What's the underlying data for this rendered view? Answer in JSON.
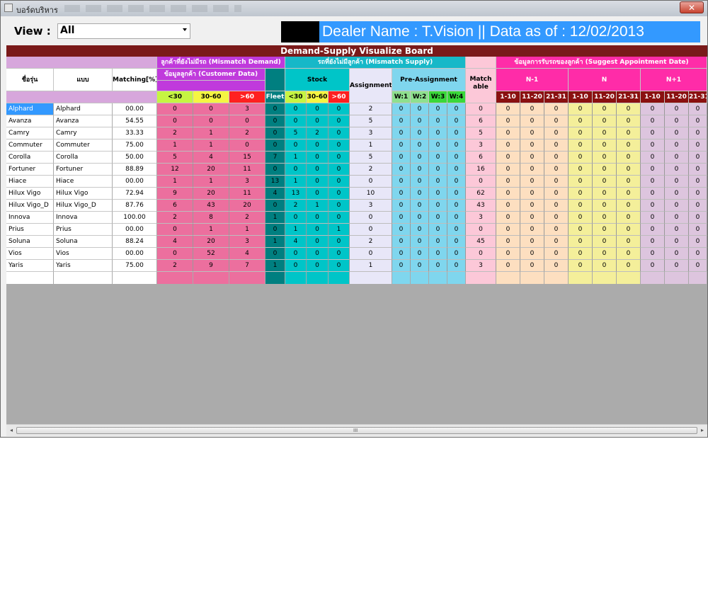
{
  "window": {
    "title": "บอร์ดบริหาร",
    "close_label": "✕"
  },
  "toolbar": {
    "view_label": "View :",
    "view_value": "All",
    "dealer_text": "Dealer Name : T.Vision || Data as of : 12/02/2013"
  },
  "board": {
    "title": "Demand-Supply Visualize Board",
    "groups": {
      "mismatch_demand": "ลูกค้าที่ยังไม่มีรถ (Mismatch Demand)",
      "mismatch_supply": "รถที่ยังไม่มีลูกค้า (Mismatch Supply)",
      "suggest_appointment": "ข้อมูลการรับรถของลูกค้า (Suggest Appointment Date)"
    },
    "subgroups": {
      "customer_data": "ข้อมูลลูกค้า (Customer Data)",
      "stock": "Stock",
      "pre_assignment": "Pre-Assignment",
      "n_minus_1": "N-1",
      "n": "N",
      "n_plus_1": "N+1"
    },
    "headers": {
      "model_code": "ชื่อรุ่น",
      "model": "แบบ",
      "matching": "Matching[%]",
      "assignment": "Assignment",
      "matchable": "Match able",
      "lt30": "<30",
      "d30_60": "30-60",
      "gt60": ">60",
      "fleet": "Fleet",
      "w1": "W:1",
      "w2": "W:2",
      "w3": "W:3",
      "w4": "W:4",
      "p1_10": "1-10",
      "p11_20": "11-20",
      "p21_31": "21-31"
    },
    "rows": [
      {
        "code": "Alphard",
        "model": "Alphard",
        "matching": "00.00",
        "vals": [
          "0",
          "0",
          "3",
          "0",
          "0",
          "0",
          "0",
          "2",
          "0",
          "0",
          "0",
          "0",
          "0",
          "0",
          "0",
          "0",
          "0",
          "0",
          "0",
          "0",
          "0",
          "0"
        ]
      },
      {
        "code": "Avanza",
        "model": "Avanza",
        "matching": "54.55",
        "vals": [
          "0",
          "0",
          "0",
          "0",
          "0",
          "0",
          "0",
          "5",
          "0",
          "0",
          "0",
          "0",
          "6",
          "0",
          "0",
          "0",
          "0",
          "0",
          "0",
          "0",
          "0",
          "0"
        ]
      },
      {
        "code": "Camry",
        "model": "Camry",
        "matching": "33.33",
        "vals": [
          "2",
          "1",
          "2",
          "0",
          "5",
          "2",
          "0",
          "3",
          "0",
          "0",
          "0",
          "0",
          "5",
          "0",
          "0",
          "0",
          "0",
          "0",
          "0",
          "0",
          "0",
          "0"
        ]
      },
      {
        "code": "Commuter",
        "model": "Commuter",
        "matching": "75.00",
        "vals": [
          "1",
          "1",
          "0",
          "0",
          "0",
          "0",
          "0",
          "1",
          "0",
          "0",
          "0",
          "0",
          "3",
          "0",
          "0",
          "0",
          "0",
          "0",
          "0",
          "0",
          "0",
          "0"
        ]
      },
      {
        "code": "Corolla",
        "model": "Corolla",
        "matching": "50.00",
        "vals": [
          "5",
          "4",
          "15",
          "7",
          "1",
          "0",
          "0",
          "5",
          "0",
          "0",
          "0",
          "0",
          "6",
          "0",
          "0",
          "0",
          "0",
          "0",
          "0",
          "0",
          "0",
          "0"
        ]
      },
      {
        "code": "Fortuner",
        "model": "Fortuner",
        "matching": "88.89",
        "vals": [
          "12",
          "20",
          "11",
          "0",
          "0",
          "0",
          "0",
          "2",
          "0",
          "0",
          "0",
          "0",
          "16",
          "0",
          "0",
          "0",
          "0",
          "0",
          "0",
          "0",
          "0",
          "0"
        ]
      },
      {
        "code": "Hiace",
        "model": "Hiace",
        "matching": "00.00",
        "vals": [
          "1",
          "1",
          "3",
          "13",
          "1",
          "0",
          "0",
          "0",
          "0",
          "0",
          "0",
          "0",
          "0",
          "0",
          "0",
          "0",
          "0",
          "0",
          "0",
          "0",
          "0",
          "0"
        ]
      },
      {
        "code": "Hilux Vigo",
        "model": "Hilux Vigo",
        "matching": "72.94",
        "vals": [
          "9",
          "20",
          "11",
          "4",
          "13",
          "0",
          "0",
          "10",
          "0",
          "0",
          "0",
          "0",
          "62",
          "0",
          "0",
          "0",
          "0",
          "0",
          "0",
          "0",
          "0",
          "0"
        ]
      },
      {
        "code": "Hilux Vigo_D",
        "model": "Hilux Vigo_D",
        "matching": "87.76",
        "vals": [
          "6",
          "43",
          "20",
          "0",
          "2",
          "1",
          "0",
          "3",
          "0",
          "0",
          "0",
          "0",
          "43",
          "0",
          "0",
          "0",
          "0",
          "0",
          "0",
          "0",
          "0",
          "0"
        ]
      },
      {
        "code": "Innova",
        "model": "Innova",
        "matching": "100.00",
        "vals": [
          "2",
          "8",
          "2",
          "1",
          "0",
          "0",
          "0",
          "0",
          "0",
          "0",
          "0",
          "0",
          "3",
          "0",
          "0",
          "0",
          "0",
          "0",
          "0",
          "0",
          "0",
          "0"
        ]
      },
      {
        "code": "Prius",
        "model": "Prius",
        "matching": "00.00",
        "vals": [
          "0",
          "1",
          "1",
          "0",
          "1",
          "0",
          "1",
          "0",
          "0",
          "0",
          "0",
          "0",
          "0",
          "0",
          "0",
          "0",
          "0",
          "0",
          "0",
          "0",
          "0",
          "0"
        ]
      },
      {
        "code": "Soluna",
        "model": "Soluna",
        "matching": "88.24",
        "vals": [
          "4",
          "20",
          "3",
          "1",
          "4",
          "0",
          "0",
          "2",
          "0",
          "0",
          "0",
          "0",
          "45",
          "0",
          "0",
          "0",
          "0",
          "0",
          "0",
          "0",
          "0",
          "0"
        ]
      },
      {
        "code": "Vios",
        "model": "Vios",
        "matching": "00.00",
        "vals": [
          "0",
          "52",
          "4",
          "0",
          "0",
          "0",
          "0",
          "0",
          "0",
          "0",
          "0",
          "0",
          "0",
          "0",
          "0",
          "0",
          "0",
          "0",
          "0",
          "0",
          "0",
          "0"
        ]
      },
      {
        "code": "Yaris",
        "model": "Yaris",
        "matching": "75.00",
        "vals": [
          "2",
          "9",
          "7",
          "1",
          "0",
          "0",
          "0",
          "1",
          "0",
          "0",
          "0",
          "0",
          "3",
          "0",
          "0",
          "0",
          "0",
          "0",
          "0",
          "0",
          "0",
          "0"
        ]
      }
    ]
  },
  "scrollbar": {
    "left_arrow": "◂",
    "right_arrow": "▸",
    "grip": "III"
  }
}
